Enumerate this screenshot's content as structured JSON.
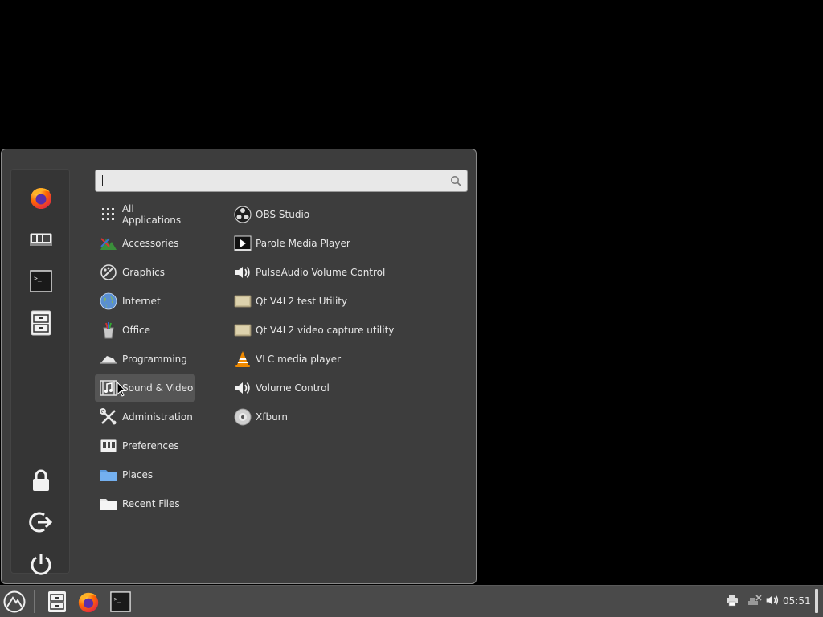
{
  "menu": {
    "search": {
      "placeholder": "",
      "value": ""
    },
    "favorites": [
      {
        "name": "firefox-icon"
      },
      {
        "name": "settings-manager-icon"
      },
      {
        "name": "terminal-icon"
      },
      {
        "name": "file-manager-icon"
      }
    ],
    "session": [
      {
        "name": "lock-icon"
      },
      {
        "name": "logout-icon"
      },
      {
        "name": "power-icon"
      }
    ],
    "categories": [
      {
        "label": "All Applications",
        "icon": "grid-icon"
      },
      {
        "label": "Accessories",
        "icon": "accessories-icon"
      },
      {
        "label": "Graphics",
        "icon": "graphics-icon"
      },
      {
        "label": "Internet",
        "icon": "globe-icon"
      },
      {
        "label": "Office",
        "icon": "office-icon"
      },
      {
        "label": "Programming",
        "icon": "programming-icon"
      },
      {
        "label": "Sound & Video",
        "icon": "sound-video-icon",
        "selected": true
      },
      {
        "label": "Administration",
        "icon": "tools-icon"
      },
      {
        "label": "Preferences",
        "icon": "preferences-icon"
      },
      {
        "label": "Places",
        "icon": "folder-icon"
      },
      {
        "label": "Recent Files",
        "icon": "recent-files-icon"
      }
    ],
    "apps": [
      {
        "label": "OBS Studio",
        "icon": "obs-icon"
      },
      {
        "label": "Parole Media Player",
        "icon": "media-player-icon"
      },
      {
        "label": "PulseAudio Volume Control",
        "icon": "speaker-icon"
      },
      {
        "label": "Qt V4L2 test Utility",
        "icon": "webcam-icon"
      },
      {
        "label": "Qt V4L2 video capture utility",
        "icon": "webcam-icon"
      },
      {
        "label": "VLC media player",
        "icon": "vlc-icon"
      },
      {
        "label": "Volume Control",
        "icon": "speaker-icon"
      },
      {
        "label": "Xfburn",
        "icon": "disc-icon"
      }
    ]
  },
  "taskbar": {
    "clock": "05:51"
  }
}
